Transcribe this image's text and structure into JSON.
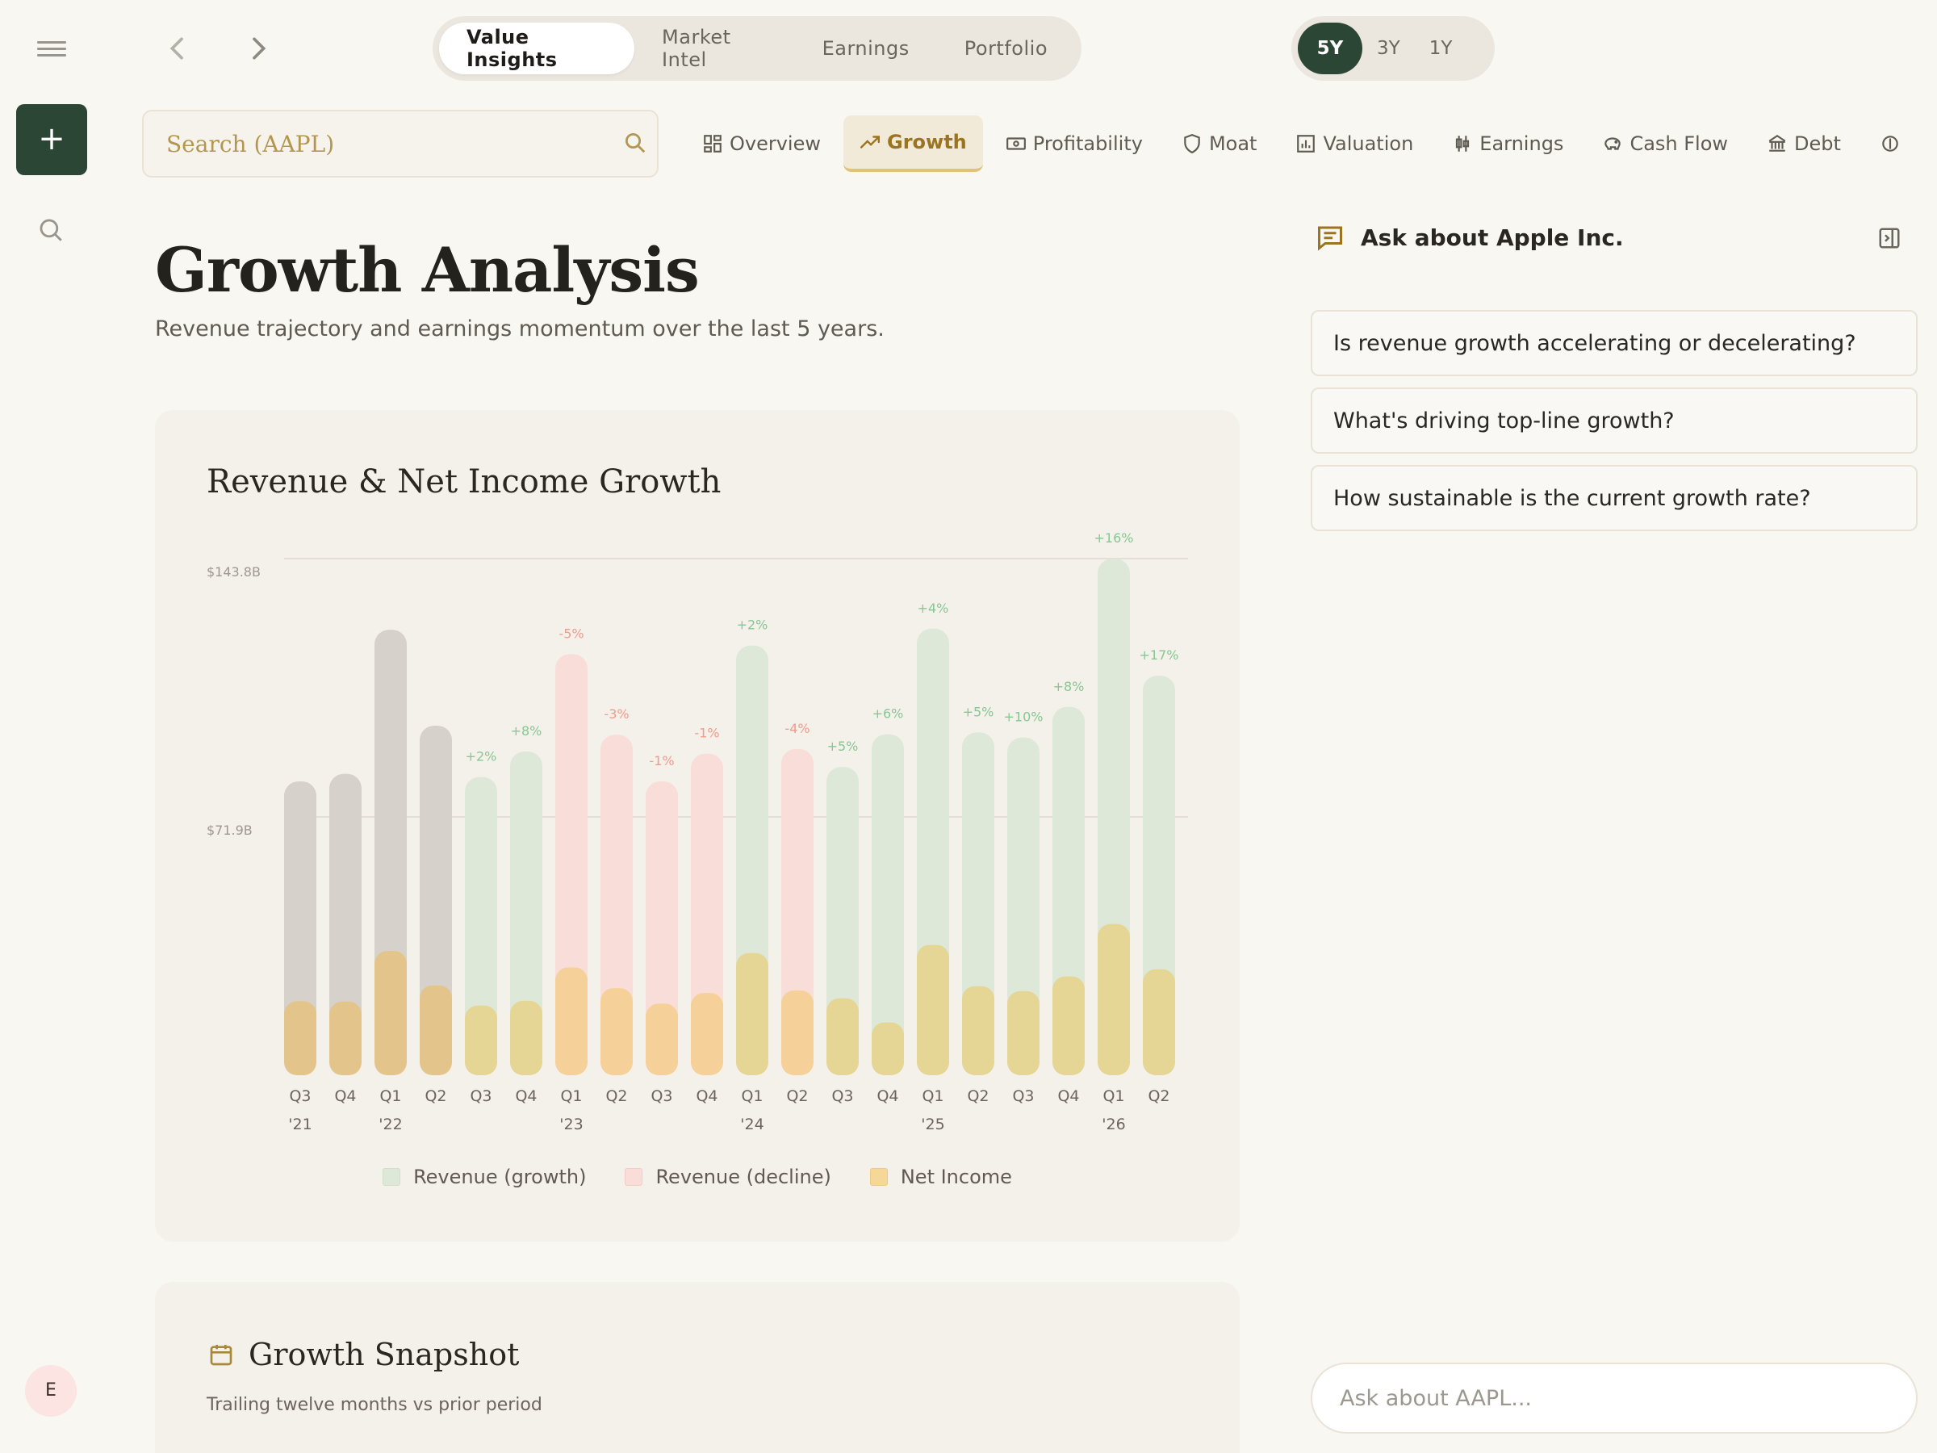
{
  "nav": {
    "modes": [
      {
        "label": "Value Insights",
        "active": true
      },
      {
        "label": "Market Intel",
        "active": false
      },
      {
        "label": "Earnings",
        "active": false
      },
      {
        "label": "Portfolio",
        "active": false
      }
    ],
    "ranges": [
      {
        "label": "5Y",
        "active": true
      },
      {
        "label": "3Y",
        "active": false
      },
      {
        "label": "1Y",
        "active": false
      }
    ]
  },
  "search": {
    "placeholder": "Search (AAPL)"
  },
  "tabs": [
    {
      "label": "Overview",
      "icon": "grid-icon",
      "active": false
    },
    {
      "label": "Growth",
      "icon": "trending-up-icon",
      "active": true
    },
    {
      "label": "Profitability",
      "icon": "banknote-icon",
      "active": false
    },
    {
      "label": "Moat",
      "icon": "shield-icon",
      "active": false
    },
    {
      "label": "Valuation",
      "icon": "bar-chart-icon",
      "active": false
    },
    {
      "label": "Earnings",
      "icon": "candlestick-icon",
      "active": false
    },
    {
      "label": "Cash Flow",
      "icon": "piggy-bank-icon",
      "active": false
    },
    {
      "label": "Debt",
      "icon": "bank-icon",
      "active": false
    },
    {
      "label": "",
      "icon": "currency-icon",
      "active": false
    }
  ],
  "page": {
    "title": "Growth Analysis",
    "subtitle": "Revenue trajectory and earnings momentum over the last 5 years."
  },
  "chart_data": {
    "type": "bar",
    "title": "Revenue & Net Income Growth",
    "y_ticks": [
      {
        "value": 143.8,
        "label": "$143.8B"
      },
      {
        "value": 71.9,
        "label": "$71.9B"
      }
    ],
    "ylim": [
      0,
      143.8
    ],
    "grid": true,
    "legend_position": "bottom",
    "quarters": [
      "Q3",
      "Q4",
      "Q1",
      "Q2",
      "Q3",
      "Q4",
      "Q1",
      "Q2",
      "Q3",
      "Q4",
      "Q1",
      "Q2",
      "Q3",
      "Q4",
      "Q1",
      "Q2",
      "Q3",
      "Q4",
      "Q1",
      "Q2"
    ],
    "years": [
      "'21",
      "",
      "'22",
      "",
      "",
      "",
      "'23",
      "",
      "",
      "",
      "'24",
      "",
      "",
      "",
      "'25",
      "",
      "",
      "",
      "'26",
      ""
    ],
    "growth_labels": [
      "",
      "",
      "",
      "",
      "+2%",
      "+8%",
      "-5%",
      "-3%",
      "-1%",
      "-1%",
      "+2%",
      "-4%",
      "+5%",
      "+6%",
      "+4%",
      "+5%",
      "+10%",
      "+8%",
      "+16%",
      "+17%"
    ],
    "series": [
      {
        "name": "Revenue",
        "values": [
          81.8,
          83.9,
          124.0,
          97.3,
          83.0,
          90.1,
          117.2,
          94.8,
          81.8,
          89.5,
          119.6,
          90.8,
          85.8,
          94.9,
          124.3,
          95.4,
          94.0,
          102.5,
          143.8,
          111.2
        ]
      },
      {
        "name": "Net Income",
        "values": [
          20.6,
          20.5,
          34.6,
          25.0,
          19.4,
          20.7,
          30.0,
          24.2,
          19.9,
          22.9,
          34.0,
          23.6,
          21.4,
          14.7,
          36.3,
          24.8,
          23.4,
          27.5,
          42.1,
          29.5
        ]
      }
    ],
    "legend": [
      {
        "label": "Revenue (growth)",
        "color": "#dde8d8"
      },
      {
        "label": "Revenue (decline)",
        "color": "#f8ddd8"
      },
      {
        "label": "Net Income",
        "color": "#f5d898"
      }
    ],
    "colors": {
      "neutral": "#d6d1ca",
      "growth": "#dde8d8",
      "decline": "#f8ddd8",
      "growth_text": "#86c793",
      "decline_text": "#f19a8e",
      "income_on_neutral": "#e3c48a",
      "income_on_growth": "#e5d695",
      "income_on_decline": "#f5d098"
    }
  },
  "snapshot": {
    "title": "Growth Snapshot",
    "subtitle": "Trailing twelve months vs prior period"
  },
  "assistant": {
    "title": "Ask about Apple Inc.",
    "prompts": [
      "Is revenue growth accelerating or decelerating?",
      "What's driving top-line growth?",
      "How sustainable is the current growth rate?"
    ],
    "input_placeholder": "Ask about AAPL..."
  },
  "user": {
    "initial": "E"
  }
}
